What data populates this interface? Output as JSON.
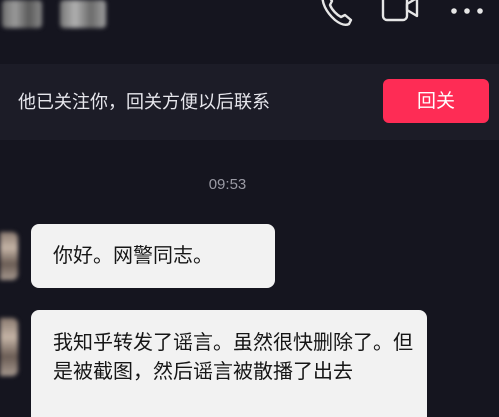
{
  "header": {
    "icons": [
      "phone-icon",
      "video-camera-icon",
      "more-icon"
    ]
  },
  "follow_banner": {
    "text": "他已关注你，回关方便以后联系",
    "button_label": "回关"
  },
  "chat": {
    "timestamp": "09:53",
    "messages": [
      {
        "text": "你好。网警同志。"
      },
      {
        "text": "我知乎转发了谣言。虽然很快删除了。但是被截图，然后谣言被散播了出去"
      }
    ]
  },
  "colors": {
    "background": "#15151f",
    "banner_bg": "#1c1c27",
    "accent": "#fe2c55",
    "bubble_bg": "#f2f2f2"
  }
}
